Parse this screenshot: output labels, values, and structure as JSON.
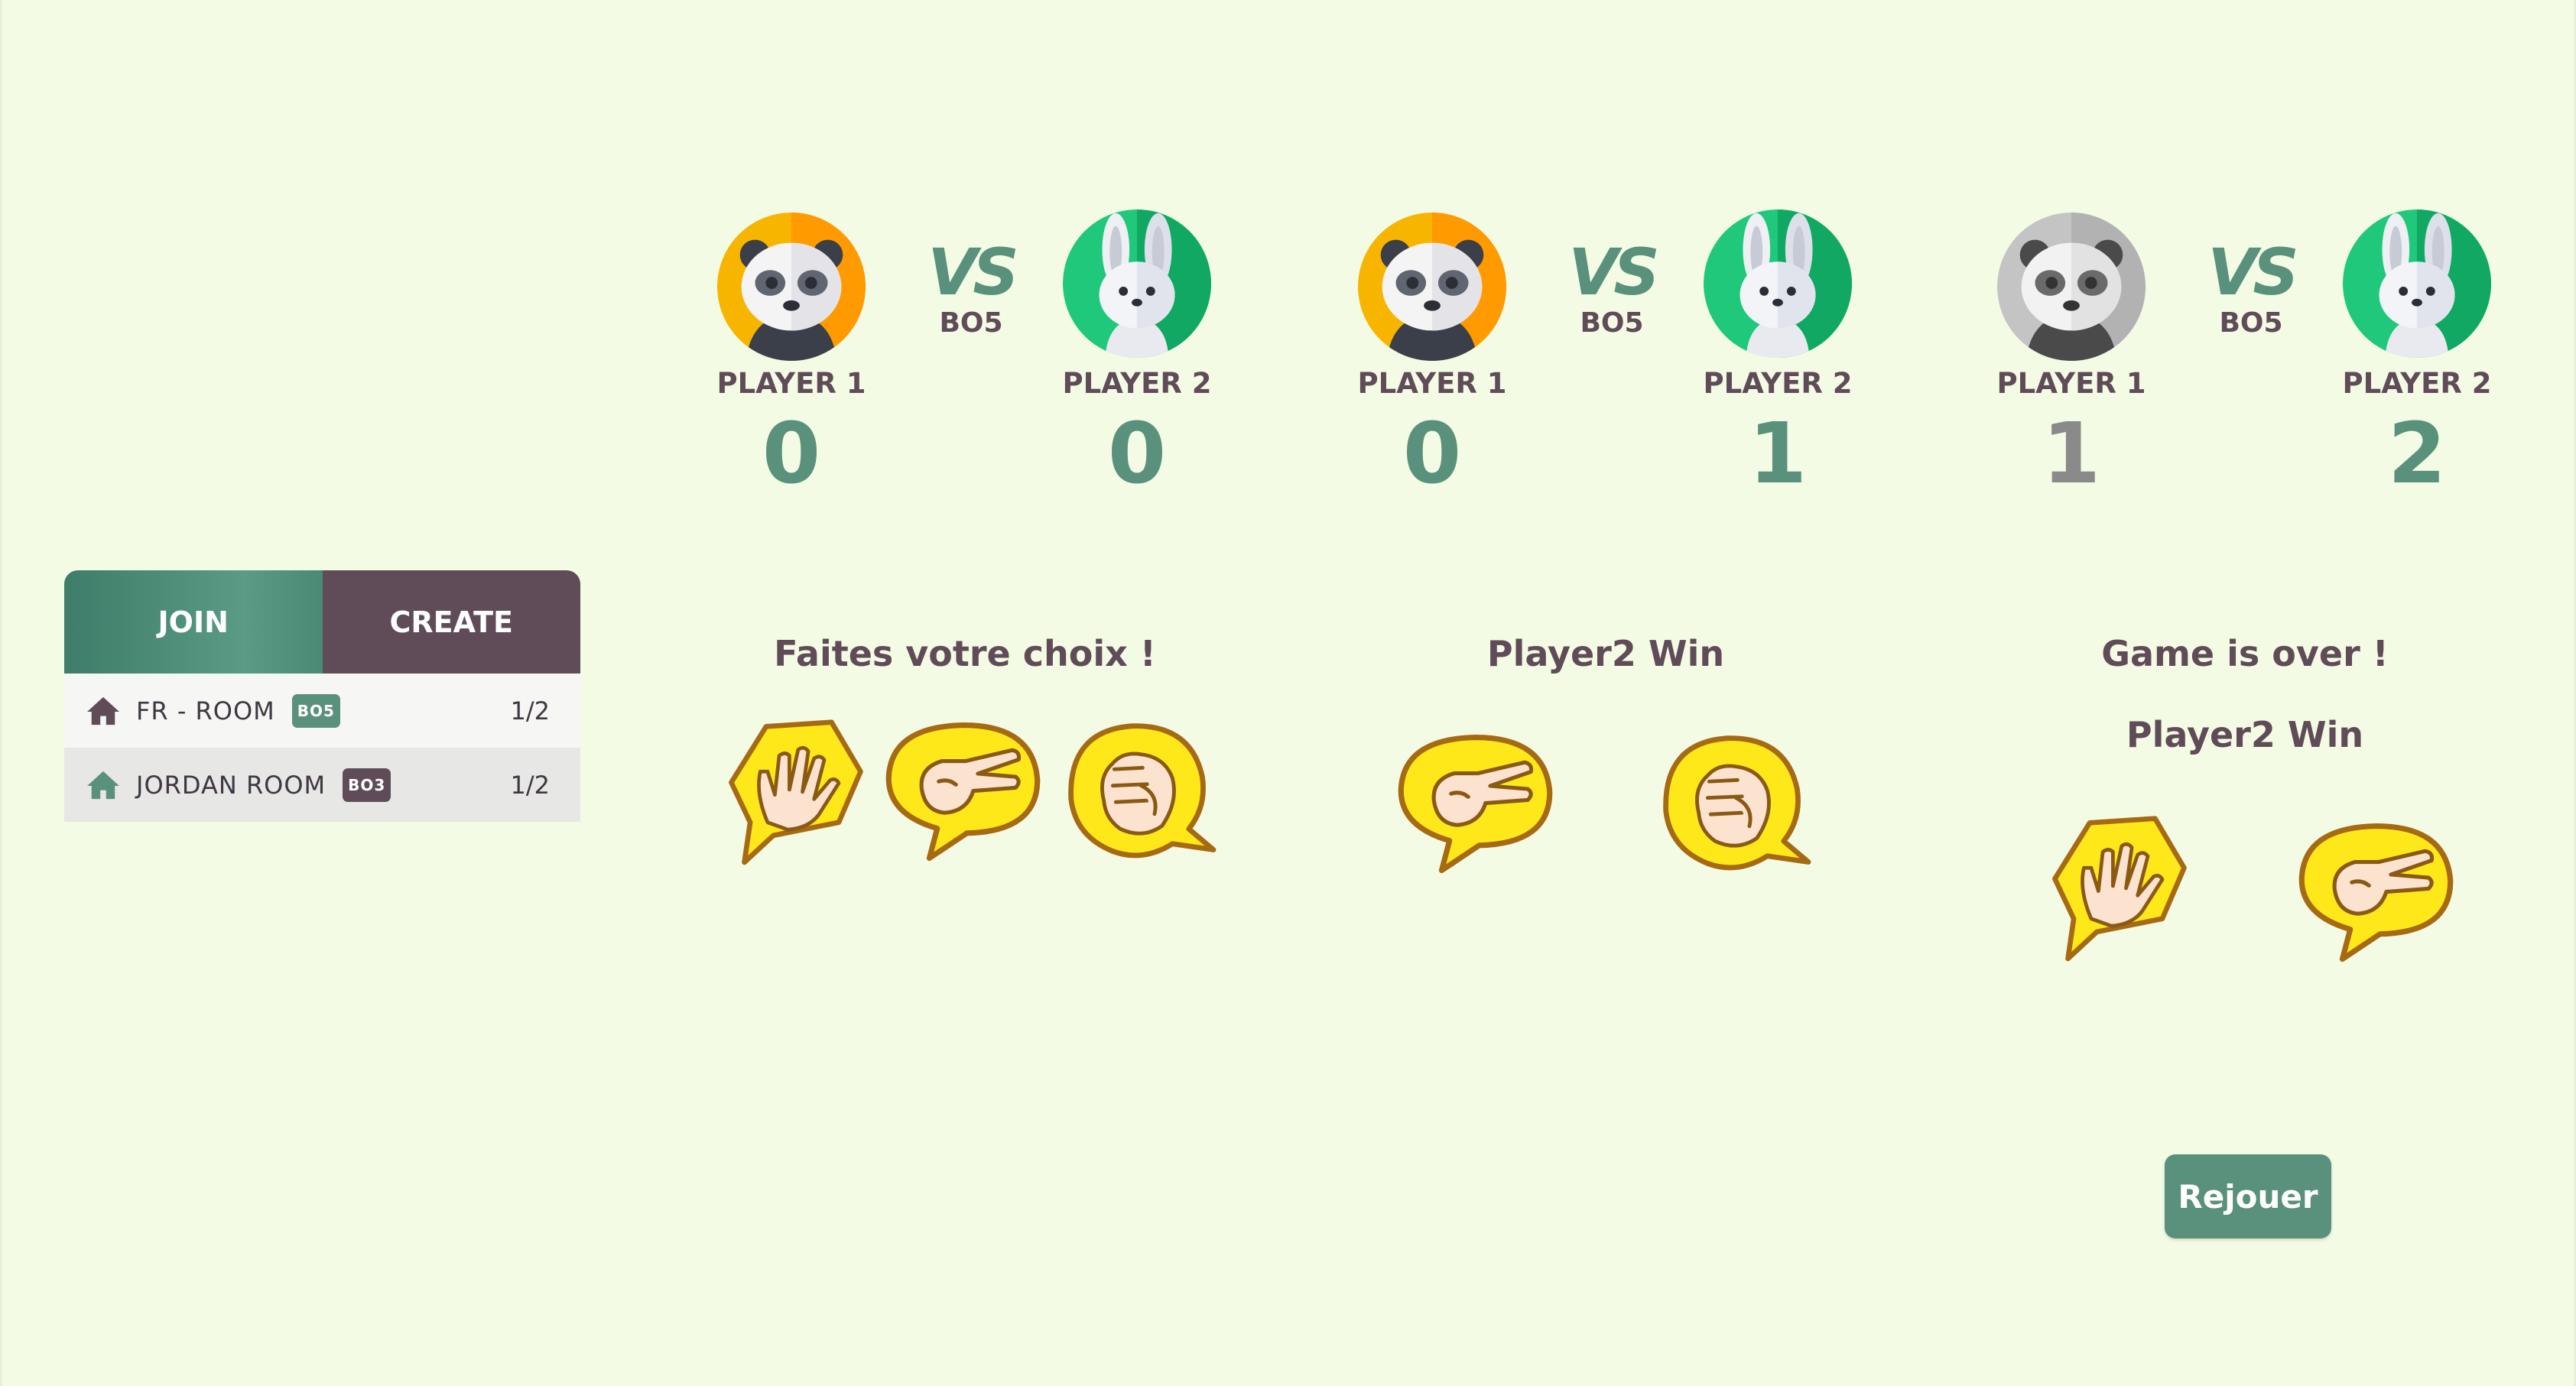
{
  "rooms_panel": {
    "tabs": {
      "join": "JOIN",
      "create": "CREATE"
    },
    "rooms": [
      {
        "name": "FR - ROOM",
        "format": "BO5",
        "badge_color": "#5a917c",
        "icon_color": "#5f4c58",
        "count": "1/2"
      },
      {
        "name": "JORDAN ROOM",
        "format": "BO3",
        "badge_color": "#5f4c58",
        "icon_color": "#5a917c",
        "count": "1/2"
      }
    ]
  },
  "games": [
    {
      "vs": "VS",
      "format": "BO5",
      "player1": {
        "name": "PLAYER 1",
        "score": "0",
        "avatar": "panda-icon"
      },
      "player2": {
        "name": "PLAYER 2",
        "score": "0",
        "avatar": "rabbit-icon"
      },
      "message": "Faites votre choix !",
      "choices": [
        "paper",
        "scissors",
        "rock"
      ]
    },
    {
      "vs": "VS",
      "format": "BO5",
      "player1": {
        "name": "PLAYER 1",
        "score": "0",
        "avatar": "panda-icon"
      },
      "player2": {
        "name": "PLAYER 2",
        "score": "1",
        "avatar": "rabbit-icon"
      },
      "message": "Player2 Win",
      "choices": [
        "scissors",
        "rock"
      ]
    },
    {
      "vs": "VS",
      "format": "BO5",
      "player1": {
        "name": "PLAYER 1",
        "score": "1",
        "avatar": "panda-icon-gray"
      },
      "player2": {
        "name": "PLAYER 2",
        "score": "2",
        "avatar": "rabbit-icon"
      },
      "message": "Game is over !",
      "result": "Player2 Win",
      "choices": [
        "paper",
        "scissors"
      ],
      "replay_label": "Rejouer"
    }
  ],
  "colors": {
    "background": "#f4fbe4",
    "accent_green": "#5a917c",
    "accent_plum": "#5f4c58",
    "panda_bg": "#f7b500",
    "rabbit_bg": "#1fc87a",
    "loser_gray": "#bdbdbd",
    "bubble_yellow": "#ffe81a"
  }
}
